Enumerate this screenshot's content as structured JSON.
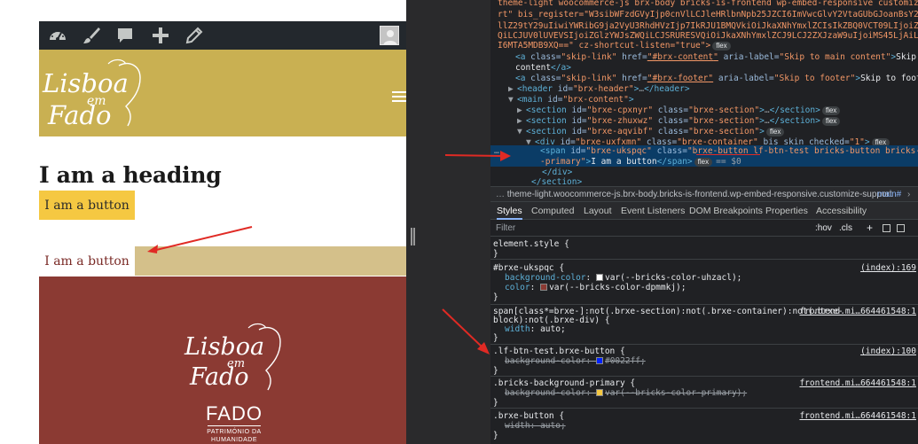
{
  "builder": {
    "toolbar_icons": [
      "dashboard-icon",
      "brush-icon",
      "comment-icon",
      "plus-icon",
      "pencil-icon"
    ],
    "logo": {
      "line1": "Lisboa",
      "line2": "em",
      "line3": "Fado"
    },
    "heading": "I am a heading",
    "button_primary": "I am a button",
    "button_test": "I am a button",
    "footer_logo": {
      "line1": "Lisboa",
      "line2": "em",
      "line3": "Fado"
    },
    "fado_brand": {
      "word": "FADO",
      "sub1": "PATRIMÓNIO DA",
      "sub2": "HUMANIDADE"
    }
  },
  "devtools": {
    "dom": {
      "l1": "theme-light woocommerce-js brx-body bricks-is-frontend wp-embed-responsive customize-suppo",
      "l2": "rt\" bis_register=\"W3sibWFzdGVyIjp0cnVlLCJleHRlbnNpb25JZCI6ImVwcGlvY2VtaGUbGJoanBsY2drb2ZjaW",
      "l3": "llZ29tY29uIiwiYWRibG9ja2VyU3RhdHVzIjp7IkRJU1BMQVkiOiJkaXNhYmxlZCIsIkZBQ0VCT09LIjoiZGlzYWJsZW",
      "l4": "QiLCJUV0lUVEVSIjoiZGlzYWJsZWQiLCJSRURESVQiOiJkaXNhYmxlZCJ9LCJ2ZXJzaW9uIjoiMS45LjAiLCJzY29yZS",
      "l5": "I6MTA5MDB9XQ==\" cz-shortcut-listen=\"true\">",
      "skip1_href": "#brx-content",
      "skip1_label": "Skip to main content",
      "skip1_text": "Skip to main",
      "skip1_text2": "content",
      "skip2_href": "#brx-footer",
      "skip2_label": "Skip to footer",
      "skip2_text": "Skip to footer",
      "header_id": "brx-header",
      "main_id": "brx-content",
      "sec1_id": "brxe-cpxnyr",
      "sec2_id": "brxe-zhuxwz",
      "sec3_id": "brxe-aqvibf",
      "div_id": "brxe-uxfxmn",
      "div_class": "brxe-container",
      "span_id": "brxe-ukspqc",
      "span_class": "brxe-button lf-btn-test bricks-button bricks-background",
      "span_class2": "-primary",
      "span_text": "I am a button",
      "section_close": "</section>",
      "div_close": "</div>",
      "eq": "== $0",
      "flex": "flex"
    },
    "breadcrumb": {
      "text": "theme-light.woocommerce-js.brx-body.bricks-is-frontend.wp-embed-responsive.customize-support",
      "last": "main#"
    },
    "tabs": [
      "Styles",
      "Computed",
      "Layout",
      "Event Listeners",
      "DOM Breakpoints",
      "Properties",
      "Accessibility"
    ],
    "filter": {
      "placeholder": "Filter",
      "hov": ":hov",
      "cls": ".cls",
      "plus": "+"
    },
    "rules": {
      "r0_sel": "element.style {",
      "r1_sel": "#brxe-ukspqc {",
      "r1_src": "(index):169",
      "r1_p1": "background-color",
      "r1_v1": "var(--bricks-color-uhzacl);",
      "r1_p2": "color",
      "r1_v2": "var(--bricks-color-dpmmkj);",
      "r2_sel1": "span[class*=brxe-]:not(.brxe-section):not(.brxe-container):not(.brxe-",
      "r2_sel2": "block):not(.brxe-div) {",
      "r2_src": "frontend.mi…664461548:1",
      "r2_p1": "width",
      "r2_v1": "auto;",
      "r3_sel": ".lf-btn-test.brxe-button {",
      "r3_src": "(index):100",
      "r3_p1": "background-color",
      "r3_v1": "#0022ff;",
      "r4_sel": ".bricks-background-primary {",
      "r4_src": "frontend.mi…664461548:1",
      "r4_p1": "background-color",
      "r4_v1": "var(--bricks-color-primary);",
      "r5_sel": ".brxe-button {",
      "r5_src": "frontend.mi…664461548:1",
      "r5_p1": "width",
      "r5_v1": "auto;",
      "close": "}"
    }
  },
  "colors": {
    "header_gold": "#c9b052",
    "button_yellow": "#f5c842",
    "tan_band": "#d4c08a",
    "footer_red": "#8b3a33",
    "test_blue": "#0022ff",
    "arrow_red": "#e02a24"
  }
}
